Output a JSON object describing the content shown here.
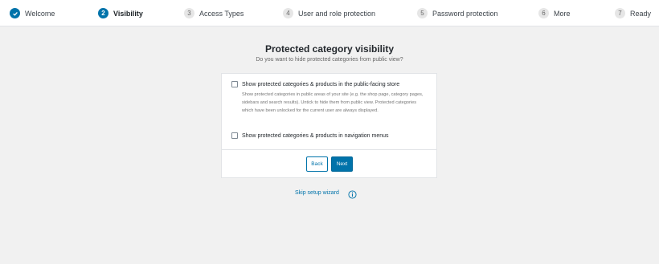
{
  "steps": [
    {
      "num": "",
      "label": "Welcome",
      "state": "done"
    },
    {
      "num": "2",
      "label": "Visibility",
      "state": "active"
    },
    {
      "num": "3",
      "label": "Access Types",
      "state": "todo"
    },
    {
      "num": "4",
      "label": "User and role protection",
      "state": "todo"
    },
    {
      "num": "5",
      "label": "Password protection",
      "state": "todo"
    },
    {
      "num": "6",
      "label": "More",
      "state": "todo"
    },
    {
      "num": "7",
      "label": "Ready",
      "state": "todo"
    }
  ],
  "header": {
    "title": "Protected category visibility",
    "subtitle": "Do you want to hide protected categories from public view?"
  },
  "card": {
    "option1_label": "Show protected categories & products in the public-facing store",
    "option1_help": "Show protected categories in public areas of your site (e.g. the shop page, category pages, sidebars and search results). Untick to hide them from public view. Protected categories which have been unlocked for the current user are always displayed.",
    "option2_label": "Show protected categories & products in navigation menus",
    "back_label": "Back",
    "next_label": "Next"
  },
  "footer": {
    "skip_label": "Skip setup wizard",
    "info_icon": "info-icon"
  },
  "colors": {
    "accent": "#0073aa",
    "background": "#f1f1f1"
  }
}
